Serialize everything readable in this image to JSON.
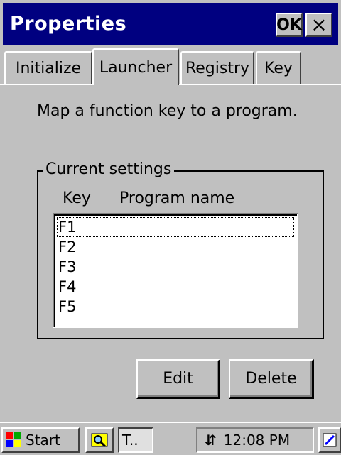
{
  "window": {
    "title": "Properties",
    "ok_label": "OK",
    "close_label": "×"
  },
  "tabs": [
    {
      "label": "Initialize",
      "active": false
    },
    {
      "label": "Launcher",
      "active": true
    },
    {
      "label": "Registry",
      "active": false
    },
    {
      "label": "Key",
      "active": false
    }
  ],
  "launcher": {
    "description": "Map a function key to a program.",
    "group_title": "Current settings",
    "columns": {
      "key": "Key",
      "program": "Program name"
    },
    "items": [
      "F1",
      "F2",
      "F3",
      "F4",
      "F5"
    ],
    "edit_label": "Edit",
    "delete_label": "Delete"
  },
  "taskbar": {
    "start_label": "Start",
    "task_label": "T..",
    "clock": "12:08 PM"
  },
  "colors": {
    "titlebar": "#000080",
    "face": "#c0c0c0"
  }
}
